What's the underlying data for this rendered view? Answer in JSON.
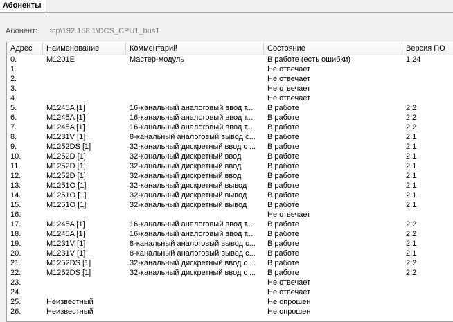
{
  "tab": {
    "label": "Абоненты"
  },
  "subscriber": {
    "label": "Абонент:",
    "value": "tcp\\192.168.1\\DCS_CPU1_bus1"
  },
  "table": {
    "headers": [
      "Адрес",
      "Наименование",
      "Комментарий",
      "Состояние",
      "Версия ПО"
    ],
    "rows": [
      [
        "0.",
        "M1201E",
        "Мастер-модуль",
        "В работе (есть ошибки)",
        "1.24"
      ],
      [
        "1.",
        "",
        "",
        "Не отвечает",
        ""
      ],
      [
        "2.",
        "",
        "",
        "Не отвечает",
        ""
      ],
      [
        "3.",
        "",
        "",
        "Не отвечает",
        ""
      ],
      [
        "4.",
        "",
        "",
        "Не отвечает",
        ""
      ],
      [
        "5.",
        "M1245A [1]",
        "16-канальный аналоговый ввод т...",
        "В работе",
        "2.2"
      ],
      [
        "6.",
        "M1245A [1]",
        "16-канальный аналоговый ввод т...",
        "В работе",
        "2.2"
      ],
      [
        "7.",
        "M1245A [1]",
        "16-канальный аналоговый ввод т...",
        "В работе",
        "2.2"
      ],
      [
        "8.",
        "M1231V [1]",
        "8-канальный аналоговый вывод с...",
        "В работе",
        "2.1"
      ],
      [
        "9.",
        "M1252DS [1]",
        "32-канальный дискретный ввод с ...",
        "В работе",
        "2.1"
      ],
      [
        "10.",
        "M1252D [1]",
        "32-канальный дискретный ввод",
        "В работе",
        "2.1"
      ],
      [
        "11.",
        "M1252D [1]",
        "32-канальный дискретный ввод",
        "В работе",
        "2.1"
      ],
      [
        "12.",
        "M1252D [1]",
        "32-канальный дискретный ввод",
        "В работе",
        "2.1"
      ],
      [
        "13.",
        "M1251O [1]",
        "32-канальный дискретный вывод",
        "В работе",
        "2.1"
      ],
      [
        "14.",
        "M1251O [1]",
        "32-канальный дискретный вывод",
        "В работе",
        "2.1"
      ],
      [
        "15.",
        "M1251O [1]",
        "32-канальный дискретный вывод",
        "В работе",
        "2.1"
      ],
      [
        "16.",
        "",
        "",
        "Не отвечает",
        ""
      ],
      [
        "17.",
        "M1245A [1]",
        "16-канальный аналоговый ввод т...",
        "В работе",
        "2.2"
      ],
      [
        "18.",
        "M1245A [1]",
        "16-канальный аналоговый ввод т...",
        "В работе",
        "2.2"
      ],
      [
        "19.",
        "M1231V [1]",
        "8-канальный аналоговый вывод с...",
        "В работе",
        "2.1"
      ],
      [
        "20.",
        "M1231V [1]",
        "8-канальный аналоговый вывод с...",
        "В работе",
        "2.1"
      ],
      [
        "21.",
        "M1252DS [1]",
        "32-канальный дискретный ввод с ...",
        "В работе",
        "2.2"
      ],
      [
        "22.",
        "M1252DS [1]",
        "32-канальный дискретный ввод с ...",
        "В работе",
        "2.2"
      ],
      [
        "23.",
        "",
        "",
        "Не отвечает",
        ""
      ],
      [
        "24.",
        "",
        "",
        "Не отвечает",
        ""
      ],
      [
        "25.",
        "Неизвестный",
        "",
        "Не опрошен",
        ""
      ],
      [
        "26.",
        "Неизвестный",
        "",
        "Не опрошен",
        ""
      ]
    ]
  }
}
